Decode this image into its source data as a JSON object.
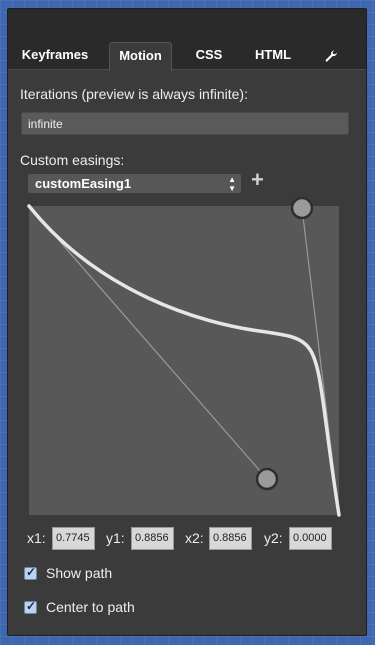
{
  "tabs": [
    {
      "label": "Keyframes",
      "active": false
    },
    {
      "label": "Motion",
      "active": true
    },
    {
      "label": "CSS",
      "active": false
    },
    {
      "label": "HTML",
      "active": false
    },
    {
      "label": "",
      "icon": "wrench-icon",
      "active": false
    }
  ],
  "iterations": {
    "label": "Iterations (preview is always infinite):",
    "value": "infinite"
  },
  "custom_easings": {
    "label": "Custom easings:",
    "selected": "customEasing1",
    "add_icon": "plus-icon",
    "arrows": "▲▼"
  },
  "bezier": {
    "x1_label": "x1:",
    "x1_value": "0.7745",
    "y1_label": "y1:",
    "y1_value": "0.8856",
    "x2_label": "x2:",
    "x2_value": "0.8856",
    "y2_label": "y2:",
    "y2_value": "0.0000"
  },
  "options": {
    "show_path": {
      "label": "Show path",
      "checked": true
    },
    "center_to_path": {
      "label": "Center to path",
      "checked": true
    }
  },
  "colors": {
    "accent_check": "#bcd3f0",
    "curve": "#e6e6e6"
  }
}
